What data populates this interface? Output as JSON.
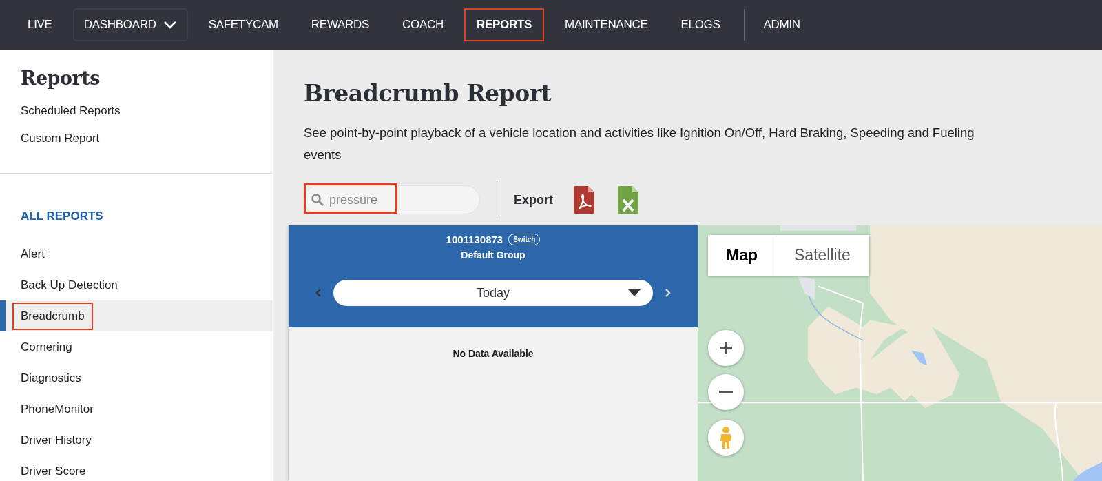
{
  "nav": [
    {
      "label": "LIVE",
      "selected": false,
      "highlighted": false,
      "kind": "link"
    },
    {
      "label": "DASHBOARD",
      "selected": false,
      "highlighted": false,
      "kind": "dropdown"
    },
    {
      "label": "SAFETYCAM",
      "selected": false,
      "highlighted": false,
      "kind": "link"
    },
    {
      "label": "REWARDS",
      "selected": false,
      "highlighted": false,
      "kind": "link"
    },
    {
      "label": "COACH",
      "selected": false,
      "highlighted": false,
      "kind": "link"
    },
    {
      "label": "REPORTS",
      "selected": true,
      "highlighted": true,
      "kind": "link"
    },
    {
      "label": "MAINTENANCE",
      "selected": false,
      "highlighted": false,
      "kind": "link"
    },
    {
      "label": "ELOGS",
      "selected": false,
      "highlighted": false,
      "kind": "link"
    },
    {
      "label": "ADMIN",
      "selected": false,
      "highlighted": false,
      "kind": "separated"
    }
  ],
  "sidebar": {
    "title": "Reports",
    "top_links": [
      "Scheduled Reports",
      "Custom Report"
    ],
    "section": "ALL REPORTS",
    "items": [
      {
        "label": "Alert",
        "selected": false,
        "highlighted": false
      },
      {
        "label": "Back Up Detection",
        "selected": false,
        "highlighted": false
      },
      {
        "label": "Breadcrumb",
        "selected": true,
        "highlighted": true
      },
      {
        "label": "Cornering",
        "selected": false,
        "highlighted": false
      },
      {
        "label": "Diagnostics",
        "selected": false,
        "highlighted": false
      },
      {
        "label": "PhoneMonitor",
        "selected": false,
        "highlighted": false
      },
      {
        "label": "Driver History",
        "selected": false,
        "highlighted": false
      },
      {
        "label": "Driver Score",
        "selected": false,
        "highlighted": false
      }
    ]
  },
  "page": {
    "title": "Breadcrumb Report",
    "description": "See point-by-point playback of a vehicle location and activities like Ignition On/Off, Hard Braking, Speeding and Fueling events"
  },
  "search": {
    "value": "pressure",
    "highlighted": true
  },
  "export": {
    "label": "Export"
  },
  "vehicle_panel": {
    "vehicle_id": "1001130873",
    "switch_label": "Switch",
    "group": "Default Group",
    "date_range": "Today",
    "empty_message": "No Data Available"
  },
  "map": {
    "kind": "picture",
    "map_types": [
      {
        "label": "Map",
        "selected": true
      },
      {
        "label": "Satellite",
        "selected": false
      }
    ]
  }
}
